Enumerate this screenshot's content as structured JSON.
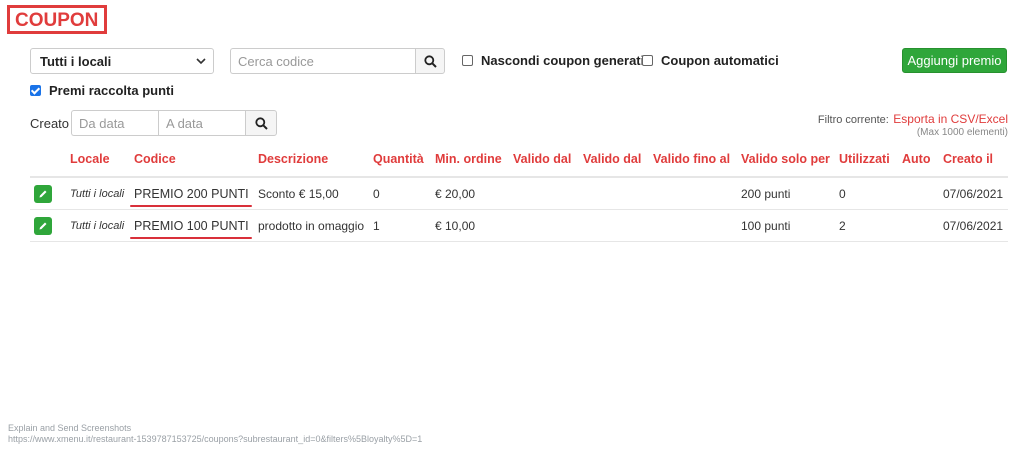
{
  "page": {
    "title": "COUPON"
  },
  "filters": {
    "location_select": "Tutti i locali",
    "search_placeholder": "Cerca codice",
    "hide_generated_label": "Nascondi coupon generati",
    "hide_generated_checked": false,
    "automatic_label": "Coupon automatici",
    "automatic_checked": false,
    "points_rewards_label": "Premi raccolta punti",
    "points_rewards_checked": true,
    "add_button": "Aggiungi premio",
    "created_label": "Creato",
    "date_from_placeholder": "Da data",
    "date_to_placeholder": "A data"
  },
  "export": {
    "current_filter_label": "Filtro corrente:",
    "export_link": "Esporta in CSV/Excel",
    "limit_note": "(Max 1000 elementi)"
  },
  "table": {
    "headers": [
      "",
      "Locale",
      "Codice",
      "Descrizione",
      "Quantità",
      "Min. ordine",
      "Valido dal",
      "Valido dal",
      "Valido fino al",
      "Valido solo per",
      "Utilizzati",
      "Auto",
      "Creato il"
    ],
    "rows": [
      {
        "locale": "Tutti i locali",
        "codice": "PREMIO 200 PUNTI",
        "descrizione": "Sconto € 15,00",
        "quantita": "0",
        "min_ordine": "€ 20,00",
        "valido_dal_1": "",
        "valido_dal_2": "",
        "valido_fino_al": "",
        "valido_solo_per": "200 punti",
        "utilizzati": "0",
        "auto": "",
        "creato_il": "07/06/2021"
      },
      {
        "locale": "Tutti i locali",
        "codice": "PREMIO 100 PUNTI",
        "descrizione": "prodotto in omaggio",
        "quantita": "1",
        "min_ordine": "€ 10,00",
        "valido_dal_1": "",
        "valido_dal_2": "",
        "valido_fino_al": "",
        "valido_solo_per": "100 punti",
        "utilizzati": "2",
        "auto": "",
        "creato_il": "07/06/2021"
      }
    ]
  },
  "footer": {
    "line1": "Explain and Send Screenshots",
    "line2": "https://www.xmenu.it/restaurant-1539787153725/coupons?subrestaurant_id=0&filters%5Bloyalty%5D=1"
  },
  "colors": {
    "accent": "#e03c3c",
    "add_button": "#2fa63a",
    "checkbox": "#1a73e8"
  }
}
